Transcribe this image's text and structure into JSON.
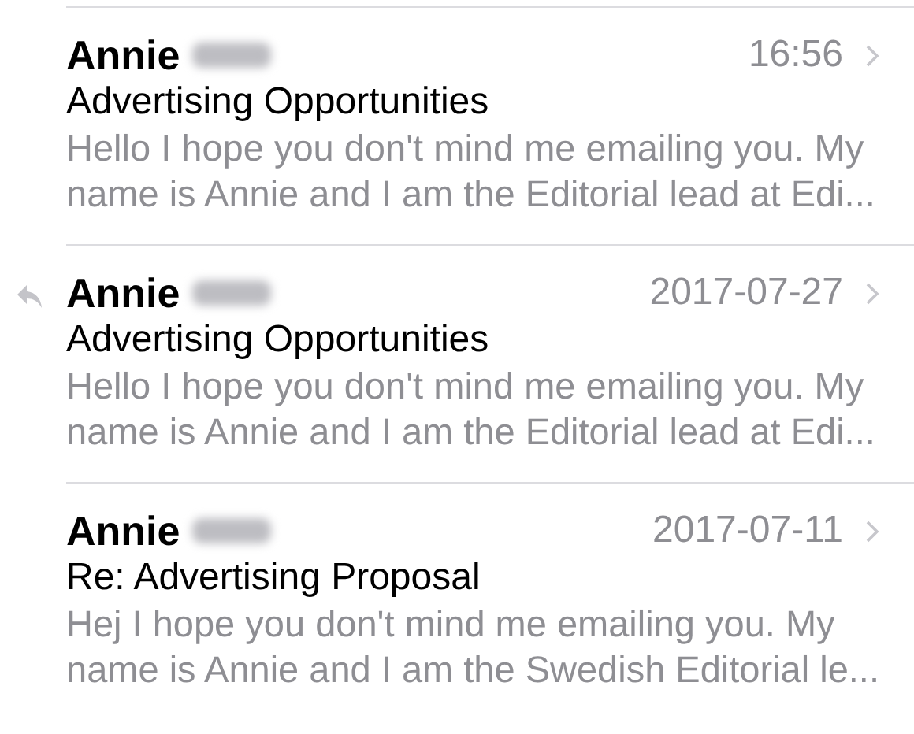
{
  "messages": [
    {
      "sender": "Annie",
      "name_redacted": true,
      "replied": false,
      "time": "16:56",
      "subject": "Advertising Opportunities",
      "preview": "Hello I hope you don't mind me emailing you. My name is Annie and I am the Editorial lead at Edi..."
    },
    {
      "sender": "Annie",
      "name_redacted": true,
      "replied": true,
      "time": "2017-07-27",
      "subject": "Advertising Opportunities",
      "preview": "Hello I hope you don't mind me emailing you. My name is Annie and I am the Editorial lead at Edi..."
    },
    {
      "sender": "Annie",
      "name_redacted": true,
      "replied": false,
      "time": "2017-07-11",
      "subject": "Re: Advertising Proposal",
      "preview": "Hej I hope you don't mind me emailing you. My name is Annie and I am the Swedish Editorial le..."
    }
  ]
}
